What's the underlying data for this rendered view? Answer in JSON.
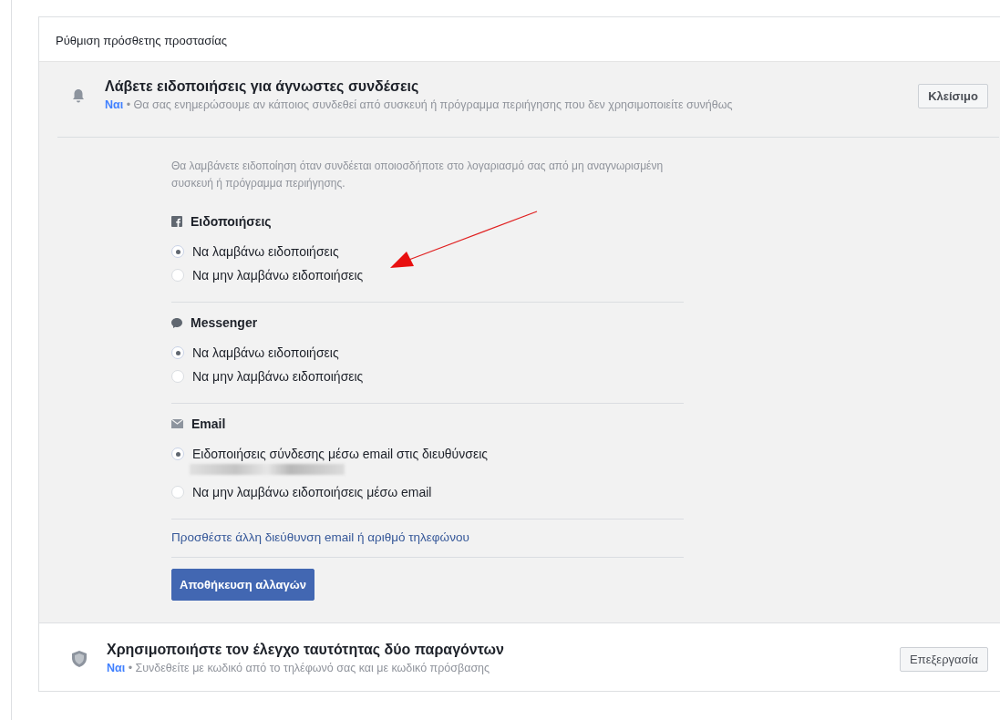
{
  "panel": {
    "title": "Ρύθμιση πρόσθετης προστασίας"
  },
  "alerts": {
    "title": "Λάβετε ειδοποιήσεις για άγνωστες συνδέσεις",
    "status": "Ναι",
    "description": "• Θα σας ενημερώσουμε αν κάποιος συνδεθεί από συσκευή ή πρόγραμμα περιήγησης που δεν χρησιμοποιείτε συνήθως",
    "button": "Κλείσιμο",
    "intro": "Θα λαμβάνετε ειδοποίηση όταν συνδέεται οποιοσδήποτε στο λογαριασμό σας από μη αναγνωρισμένη συσκευή ή πρόγραμμα περιήγησης.",
    "groups": [
      {
        "kind": "facebook",
        "label": "Ειδοποιήσεις",
        "options": [
          {
            "label": "Να λαμβάνω ειδοποιήσεις",
            "selected": true,
            "redacted": false
          },
          {
            "label": "Να μην λαμβάνω ειδοποιήσεις",
            "selected": false,
            "redacted": false
          }
        ]
      },
      {
        "kind": "messenger",
        "label": "Messenger",
        "options": [
          {
            "label": "Να λαμβάνω ειδοποιήσεις",
            "selected": true,
            "redacted": false
          },
          {
            "label": "Να μην λαμβάνω ειδοποιήσεις",
            "selected": false,
            "redacted": false
          }
        ]
      },
      {
        "kind": "email",
        "label": "Email",
        "options": [
          {
            "label": "Ειδοποιήσεις σύνδεσης μέσω email στις διευθύνσεις",
            "selected": true,
            "redacted": true
          },
          {
            "label": "Να μην λαμβάνω ειδοποιήσεις μέσω email",
            "selected": false,
            "redacted": false
          }
        ]
      }
    ],
    "link": "Προσθέστε άλλη διεύθυνση email ή αριθμό τηλεφώνου",
    "save": "Αποθήκευση αλλαγών"
  },
  "two_factor": {
    "title": "Χρησιμοποιήστε τον έλεγχο ταυτότητας δύο παραγόντων",
    "status": "Ναι",
    "description": "• Συνδεθείτε με κωδικό από το τηλέφωνό σας και με κωδικό πρόσβασης",
    "button": "Επεξεργασία"
  }
}
